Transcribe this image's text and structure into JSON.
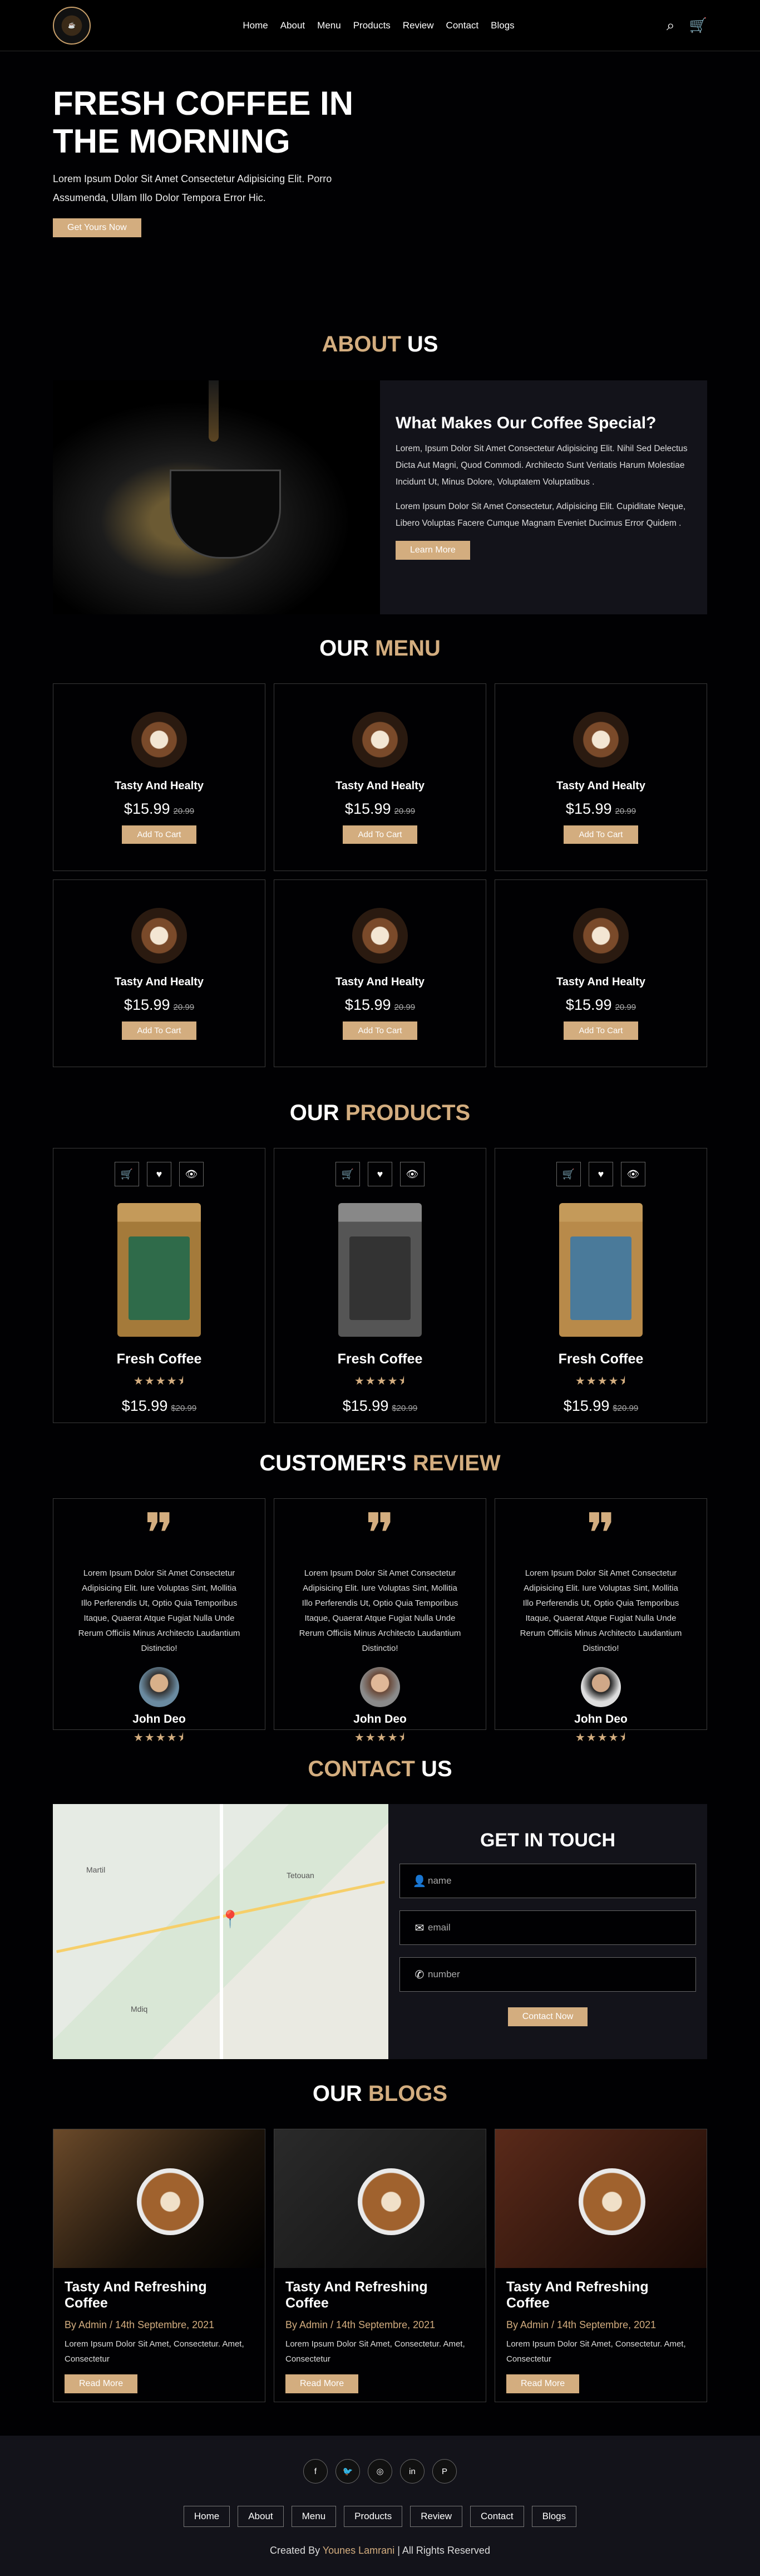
{
  "header": {
    "nav": [
      "Home",
      "About",
      "Menu",
      "Products",
      "Review",
      "Contact",
      "Blogs"
    ]
  },
  "hero": {
    "title": "FRESH COFFEE IN THE MORNING",
    "text": "Lorem Ipsum Dolor Sit Amet Consectetur Adipisicing Elit. Porro Assumenda, Ullam Illo Dolor Tempora Error Hic.",
    "button": "Get Yours Now"
  },
  "about": {
    "heading_accent": "ABOUT",
    "heading_rest": " US",
    "title": "What Makes Our Coffee Special?",
    "p1": "Lorem, Ipsum Dolor Sit Amet Consectetur Adipisicing Elit. Nihil Sed Delectus Dicta Aut Magni, Quod Commodi. Architecto Sunt Veritatis Harum Molestiae Incidunt Ut, Minus Dolore, Voluptatem Voluptatibus .",
    "p2": "Lorem Ipsum Dolor Sit Amet Consectetur, Adipisicing Elit. Cupiditate Neque, Libero Voluptas Facere Cumque Magnam Eveniet Ducimus Error Quidem .",
    "button": "Learn More"
  },
  "menu": {
    "heading_rest": "OUR ",
    "heading_accent": "MENU",
    "items": [
      {
        "name": "Tasty And Healty",
        "price": "$15.99",
        "old": "20.99",
        "button": "Add To Cart"
      },
      {
        "name": "Tasty And Healty",
        "price": "$15.99",
        "old": "20.99",
        "button": "Add To Cart"
      },
      {
        "name": "Tasty And Healty",
        "price": "$15.99",
        "old": "20.99",
        "button": "Add To Cart"
      },
      {
        "name": "Tasty And Healty",
        "price": "$15.99",
        "old": "20.99",
        "button": "Add To Cart"
      },
      {
        "name": "Tasty And Healty",
        "price": "$15.99",
        "old": "20.99",
        "button": "Add To Cart"
      },
      {
        "name": "Tasty And Healty",
        "price": "$15.99",
        "old": "20.99",
        "button": "Add To Cart"
      }
    ]
  },
  "products": {
    "heading_rest": "OUR ",
    "heading_accent": "PRODUCTS",
    "items": [
      {
        "name": "Fresh Coffee",
        "price": "$15.99",
        "old": "$20.99",
        "rating": 4.5
      },
      {
        "name": "Fresh Coffee",
        "price": "$15.99",
        "old": "$20.99",
        "rating": 4.5
      },
      {
        "name": "Fresh Coffee",
        "price": "$15.99",
        "old": "$20.99",
        "rating": 4.5
      }
    ]
  },
  "review": {
    "heading_rest": "CUSTOMER'S ",
    "heading_accent": "REVIEW",
    "items": [
      {
        "text": "Lorem Ipsum Dolor Sit Amet Consectetur Adipisicing Elit. Iure Voluptas Sint, Mollitia Illo Perferendis Ut, Optio Quia Temporibus Itaque, Quaerat Atque Fugiat Nulla Unde Rerum Officiis Minus Architecto Laudantium Distinctio!",
        "name": "John Deo",
        "rating": 4.5
      },
      {
        "text": "Lorem Ipsum Dolor Sit Amet Consectetur Adipisicing Elit. Iure Voluptas Sint, Mollitia Illo Perferendis Ut, Optio Quia Temporibus Itaque, Quaerat Atque Fugiat Nulla Unde Rerum Officiis Minus Architecto Laudantium Distinctio!",
        "name": "John Deo",
        "rating": 4.5
      },
      {
        "text": "Lorem Ipsum Dolor Sit Amet Consectetur Adipisicing Elit. Iure Voluptas Sint, Mollitia Illo Perferendis Ut, Optio Quia Temporibus Itaque, Quaerat Atque Fugiat Nulla Unde Rerum Officiis Minus Architecto Laudantium Distinctio!",
        "name": "John Deo",
        "rating": 4.5
      }
    ]
  },
  "contact": {
    "heading_accent": "CONTACT",
    "heading_rest": " US",
    "form_title": "GET IN TOUCH",
    "fields": [
      {
        "icon": "user-icon",
        "placeholder": "name"
      },
      {
        "icon": "envelope-icon",
        "placeholder": "email"
      },
      {
        "icon": "phone-icon",
        "placeholder": "number"
      }
    ],
    "button": "Contact Now",
    "map_labels": [
      "Martil",
      "Tetouan",
      "Mdiq"
    ]
  },
  "blogs": {
    "heading_rest": "OUR ",
    "heading_accent": "BLOGS",
    "items": [
      {
        "title": "Tasty And Refreshing Coffee",
        "by": "By Admin / 14th Septembre, 2021",
        "text": "Lorem Ipsum Dolor Sit Amet, Consectetur. Amet, Consectetur",
        "button": "Read More"
      },
      {
        "title": "Tasty And Refreshing Coffee",
        "by": "By Admin / 14th Septembre, 2021",
        "text": "Lorem Ipsum Dolor Sit Amet, Consectetur. Amet, Consectetur",
        "button": "Read More"
      },
      {
        "title": "Tasty And Refreshing Coffee",
        "by": "By Admin / 14th Septembre, 2021",
        "text": "Lorem Ipsum Dolor Sit Amet, Consectetur. Amet, Consectetur",
        "button": "Read More"
      }
    ]
  },
  "footer": {
    "links": [
      "Home",
      "About",
      "Menu",
      "Products",
      "Review",
      "Contact",
      "Blogs"
    ],
    "credit_pre": "Created By ",
    "credit_name": "Younes Lamrani",
    "credit_post": " | All Rights Reserved"
  },
  "colors": {
    "accent": "#d3ad7f",
    "background": "#010103",
    "panel": "#13131a"
  }
}
